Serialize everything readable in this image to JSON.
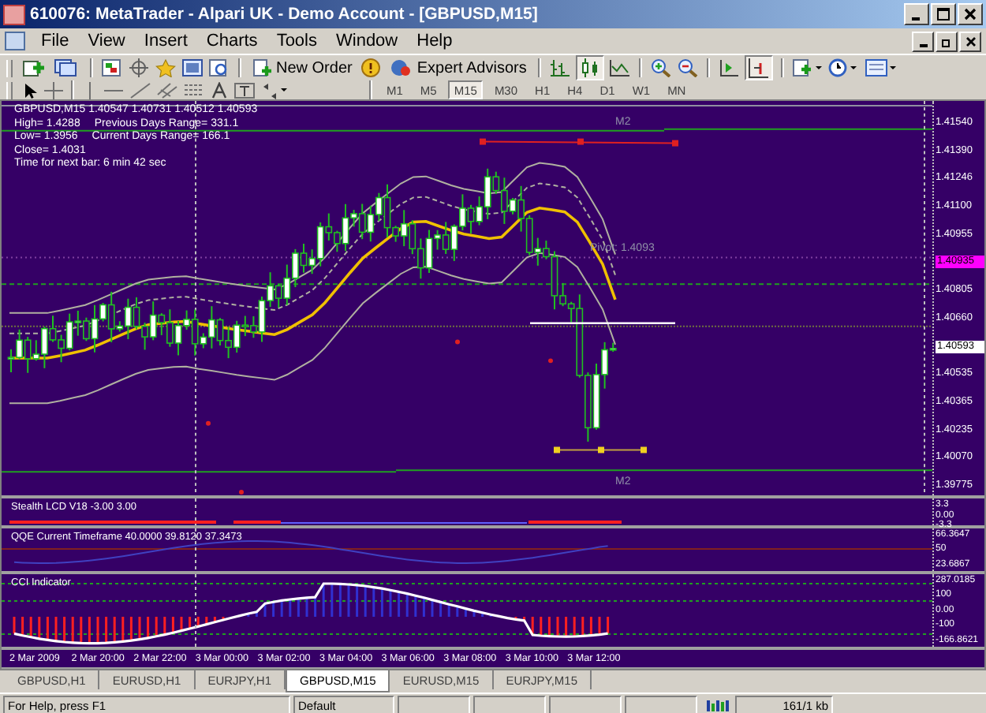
{
  "window": {
    "title": "610076: MetaTrader - Alpari UK - Demo Account - [GBPUSD,M15]"
  },
  "menu": [
    "File",
    "View",
    "Insert",
    "Charts",
    "Tools",
    "Window",
    "Help"
  ],
  "toolbar": {
    "buttons": [
      "New Order",
      "Expert Advisors"
    ]
  },
  "timeframes": [
    {
      "label": "M1",
      "selected": false
    },
    {
      "label": "M5",
      "selected": false
    },
    {
      "label": "M15",
      "selected": true
    },
    {
      "label": "M30",
      "selected": false
    },
    {
      "label": "H1",
      "selected": false
    },
    {
      "label": "H4",
      "selected": false
    },
    {
      "label": "D1",
      "selected": false
    },
    {
      "label": "W1",
      "selected": false
    },
    {
      "label": "MN",
      "selected": false
    }
  ],
  "chart": {
    "info": [
      [
        "GBPUSD,M15 1.40547 1.40731 1.40512 1.40593"
      ],
      [
        "High= 1.4288",
        "Previous Days Range= 331.1"
      ],
      [
        "Low= 1.3956",
        "Current Days Range= 166.1"
      ],
      [
        "Close= 1.4031"
      ],
      [
        "Time for next bar: 6 min 42 sec"
      ]
    ],
    "overlay_labels": [
      {
        "kind": "top",
        "text": "M2"
      },
      {
        "kind": "pivot",
        "text": "Pivot: 1.4093"
      },
      {
        "kind": "bottom",
        "text": "M2"
      }
    ],
    "price_axis": [
      {
        "kind": "tick",
        "text": "1.41540"
      },
      {
        "kind": "tick",
        "text": "1.41390"
      },
      {
        "kind": "tick",
        "text": "1.41246"
      },
      {
        "kind": "tick",
        "text": "1.41100"
      },
      {
        "kind": "tick",
        "text": "1.40955"
      },
      {
        "kind": "marker",
        "text": "1.40935",
        "color": "#ff00ff"
      },
      {
        "kind": "tick",
        "text": "1.40805"
      },
      {
        "kind": "tick",
        "text": "1.40660"
      },
      {
        "kind": "marker",
        "text": "1.40593",
        "color": "#ffffff"
      },
      {
        "kind": "tick",
        "text": "1.40535"
      },
      {
        "kind": "tick",
        "text": "1.40365"
      },
      {
        "kind": "tick",
        "text": "1.40235"
      },
      {
        "kind": "tick",
        "text": "1.40070"
      },
      {
        "kind": "tick",
        "text": "1.39775"
      }
    ]
  },
  "indicators": [
    {
      "kind": "stealth",
      "title": "Stealth LCD V18 -3.00 3.00",
      "axis": [
        "3.3",
        "0.00",
        "-3.3"
      ]
    },
    {
      "kind": "qqe",
      "title": "QQE Current Timeframe 40.0000 39.8120 37.3473",
      "axis": [
        "66.3647",
        "50",
        "23.6867"
      ]
    },
    {
      "kind": "cci",
      "title": "CCI Indicator",
      "axis": [
        "287.0185",
        "100",
        "0.00",
        "-100",
        "-166.8621"
      ]
    }
  ],
  "time_axis": [
    "2 Mar 2009",
    "2 Mar 20:00",
    "2 Mar 22:00",
    "3 Mar 00:00",
    "3 Mar 02:00",
    "3 Mar 04:00",
    "3 Mar 06:00",
    "3 Mar 08:00",
    "3 Mar 10:00",
    "3 Mar 12:00"
  ],
  "tabs": [
    {
      "label": "GBPUSD,H1",
      "selected": false
    },
    {
      "label": "EURUSD,H1",
      "selected": false
    },
    {
      "label": "EURJPY,H1",
      "selected": false
    },
    {
      "label": "GBPUSD,M15",
      "selected": true
    },
    {
      "label": "EURUSD,M15",
      "selected": false
    },
    {
      "label": "EURJPY,M15",
      "selected": false
    }
  ],
  "status_bar": [
    "For Help, press F1",
    "Default",
    "161/1 kb"
  ]
}
